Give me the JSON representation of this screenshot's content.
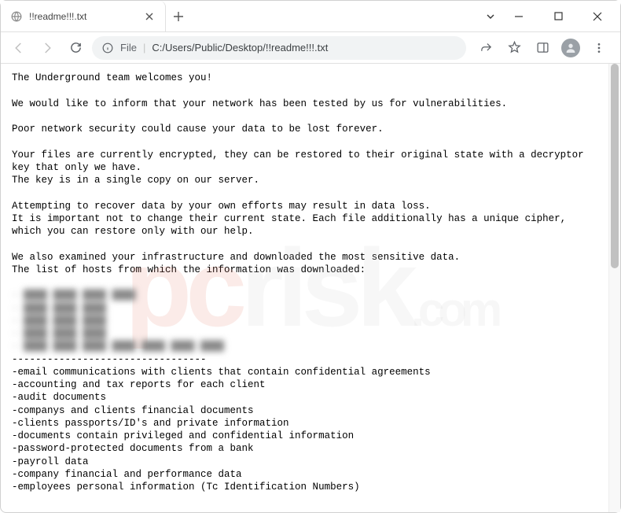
{
  "tab": {
    "title": "!!readme!!!.txt"
  },
  "omnibox": {
    "label": "File",
    "path": "C:/Users/Public/Desktop/!!readme!!!.txt"
  },
  "content": {
    "intro": "The Underground team welcomes you!",
    "p1": "We would like to inform that your network has been tested by us for vulnerabilities.",
    "p2": "Poor network security could cause your data to be lost forever.",
    "p3a": "Your files are currently encrypted, they can be restored to their original state with a decryptor key that only we have.",
    "p3b": "The key is in a single copy on our server.",
    "p4a": "Attempting to recover data by your own efforts may result in data loss.",
    "p4b": "It is important not to change their current state. Each file additionally has a unique cipher, which you can restore only with our help.",
    "p5a": "We also examined your infrastructure and downloaded the most sensitive data.",
    "p5b": "The list of hosts from which the information was downloaded:",
    "blurred": "- ████ ████ ████ ████\n- ████ ████ ████\n- ████ ████ ████\n- ████ ████ ████\n- ████ ████ ████ ████ ████ ████ ████",
    "sep": "---------------------------------",
    "items": [
      "-email communications with clients that contain confidential agreements",
      "-accounting and tax reports for each client",
      "-audit documents",
      "-companys and clients financial documents",
      "-clients passports/ID's and private information",
      "-documents contain privileged and confidential information",
      "-password-protected documents from a bank",
      "-payroll data",
      "-company financial and performance data",
      "-employees personal information (Tc Identification Numbers)"
    ]
  }
}
